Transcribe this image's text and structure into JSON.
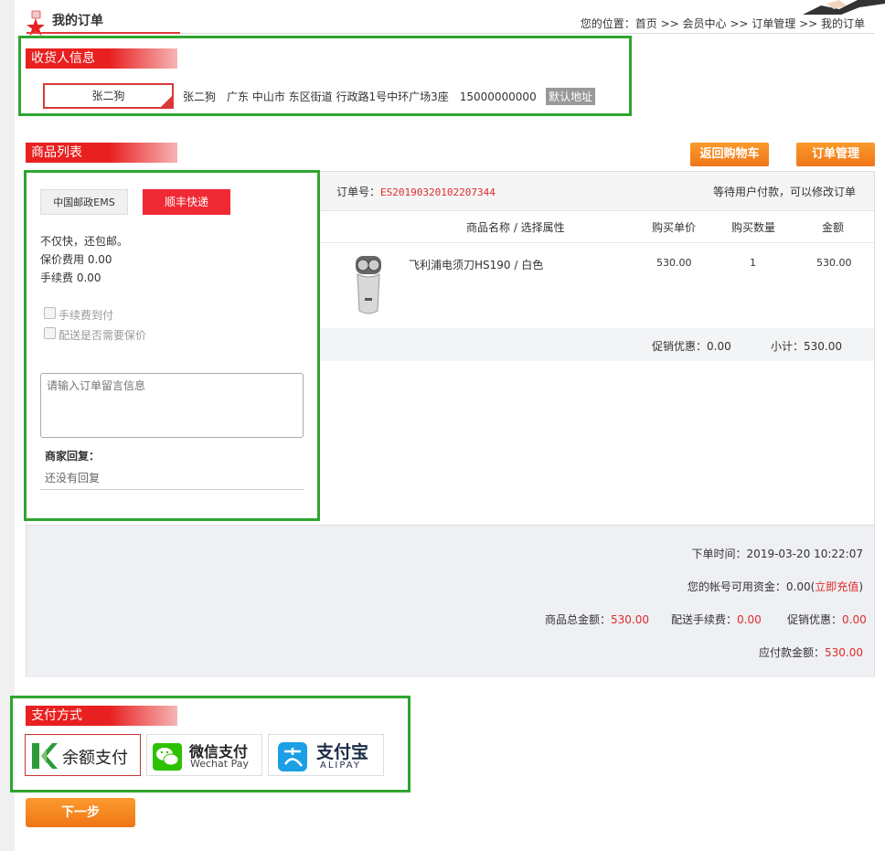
{
  "header": {
    "title": "我的订单",
    "breadcrumb": "您的位置：首页 >> 会员中心 >> 订单管理 >> 我的订单"
  },
  "receiver": {
    "section_label": "收货人信息",
    "selected_name": "张二狗",
    "detail": "张二狗　广东 中山市 东区街道 行政路1号中环广场3座　15000000000",
    "default_badge": "默认地址"
  },
  "goods": {
    "section_label": "商品列表",
    "back_to_cart": "返回购物车",
    "order_manage": "订单管理"
  },
  "shipping": {
    "options": [
      "中国邮政EMS",
      "顺丰快递"
    ],
    "selected": "顺丰快递",
    "desc": "不仅快，还包邮。",
    "insurance_fee": "保价费用 0.00",
    "handling_fee": "手续费 0.00",
    "cod_label": "手续费到付",
    "insure_label": "配送是否需要保价",
    "message_placeholder": "请输入订单留言信息",
    "merchant_reply_label": "商家回复：",
    "merchant_reply": "还没有回复"
  },
  "order": {
    "order_no_label": "订单号：",
    "order_no": "ES20190320102207344",
    "status": "等待用户付款，可以修改订单",
    "columns": [
      "商品名称 / 选择属性",
      "购买单价",
      "购买数量",
      "金额"
    ],
    "item": {
      "name": "飞利浦电须刀HS190 / 白色",
      "price": "530.00",
      "qty": "1",
      "amount": "530.00"
    },
    "promo": "促销优惠：0.00",
    "subtotal": "小计：530.00"
  },
  "summary": {
    "order_time": "下单时间：2019-03-20 10:22:07",
    "balance_label": "您的帐号可用资金：0.00(",
    "recharge": "立即充值",
    "balance_close": ")",
    "goods_total_label": "商品总金额：",
    "goods_total": "530.00",
    "shipping_fee_label": "配送手续费：",
    "shipping_fee": "0.00",
    "promo_label": "促销优惠：",
    "promo": "0.00",
    "payable_label": "应付款金额：",
    "payable": "530.00"
  },
  "payment": {
    "section_label": "支付方式",
    "balance": "余额支付",
    "wechat_cn": "微信支付",
    "wechat_en": "Wechat Pay",
    "alipay_cn": "支付宝",
    "alipay_en": "ALIPAY"
  },
  "next_button": "下一步",
  "colors": {
    "accent_red": "#e8201f",
    "orange": "#f5831f",
    "highlight_green": "#2fa52f"
  }
}
